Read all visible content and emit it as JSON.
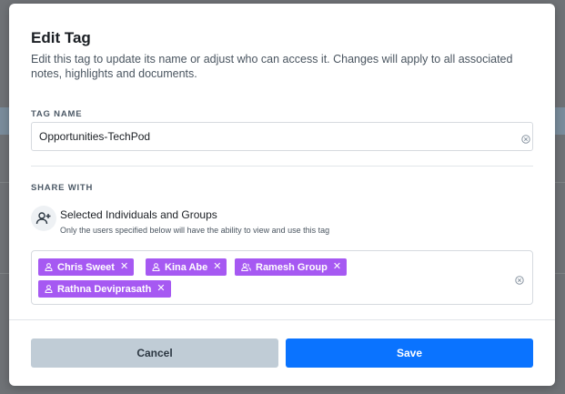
{
  "modal": {
    "title": "Edit Tag",
    "description": "Edit this tag to update its name or adjust who can access it. Changes will apply to all associated notes, highlights and documents."
  },
  "tag_name": {
    "label": "TAG NAME",
    "value": "Opportunities-TechPod"
  },
  "share_with": {
    "label": "SHARE WITH",
    "option_title": "Selected Individuals and Groups",
    "option_subtitle": "Only the users specified below will have the ability to view and use this tag",
    "option_icon": "user-add-icon",
    "chips": [
      {
        "label": "Chris Sweet",
        "icon": "user-icon"
      },
      {
        "label": "Kina Abe",
        "icon": "user-icon"
      },
      {
        "label": "Ramesh Group",
        "icon": "group-icon"
      },
      {
        "label": "Rathna Deviprasath",
        "icon": "user-icon"
      }
    ]
  },
  "footer": {
    "cancel_label": "Cancel",
    "save_label": "Save"
  },
  "colors": {
    "chip": "#a659f2",
    "save_button": "#0a73ff",
    "cancel_button": "#c0ccd6"
  }
}
